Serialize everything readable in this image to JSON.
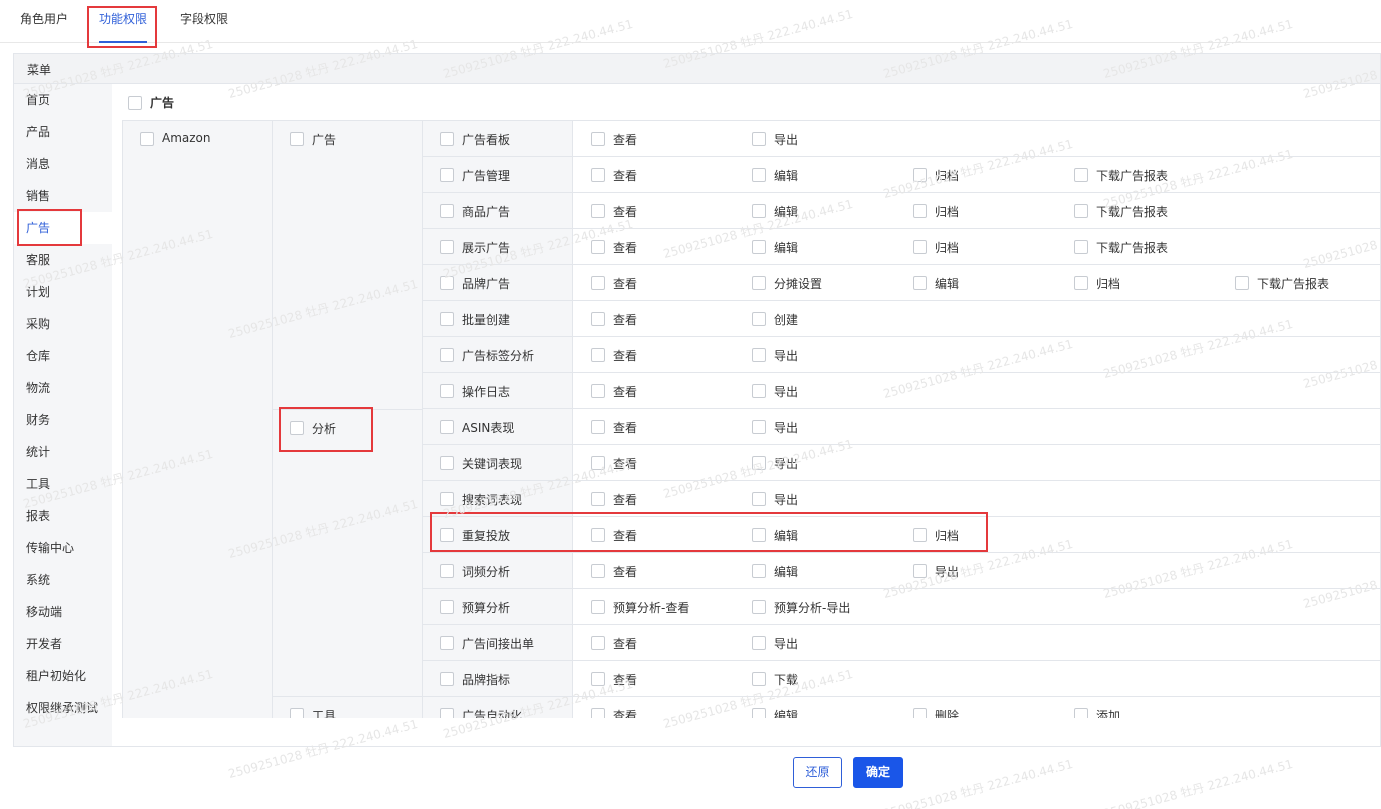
{
  "tabs": [
    {
      "label": "角色用户"
    },
    {
      "label": "功能权限"
    },
    {
      "label": "字段权限"
    }
  ],
  "panel": {
    "title": "菜单"
  },
  "menu": {
    "items": [
      {
        "label": "首页"
      },
      {
        "label": "产品"
      },
      {
        "label": "消息"
      },
      {
        "label": "销售"
      },
      {
        "label": "广告"
      },
      {
        "label": "客服"
      },
      {
        "label": "计划"
      },
      {
        "label": "采购"
      },
      {
        "label": "仓库"
      },
      {
        "label": "物流"
      },
      {
        "label": "财务"
      },
      {
        "label": "统计"
      },
      {
        "label": "工具"
      },
      {
        "label": "报表"
      },
      {
        "label": "传输中心"
      },
      {
        "label": "系统"
      },
      {
        "label": "移动端"
      },
      {
        "label": "开发者"
      },
      {
        "label": "租户初始化"
      },
      {
        "label": "权限继承测试"
      }
    ],
    "active_index": 4
  },
  "module": {
    "label": "广告"
  },
  "level1": [
    {
      "label": "Amazon"
    }
  ],
  "level2": [
    {
      "label": "广告"
    },
    {
      "label": "分析"
    },
    {
      "label": "工具"
    }
  ],
  "rows": [
    {
      "label": "广告看板",
      "perms": [
        "查看",
        "导出"
      ]
    },
    {
      "label": "广告管理",
      "perms": [
        "查看",
        "编辑",
        "归档",
        "下载广告报表"
      ]
    },
    {
      "label": "商品广告",
      "perms": [
        "查看",
        "编辑",
        "归档",
        "下载广告报表"
      ]
    },
    {
      "label": "展示广告",
      "perms": [
        "查看",
        "编辑",
        "归档",
        "下载广告报表"
      ]
    },
    {
      "label": "品牌广告",
      "perms": [
        "查看",
        "分摊设置",
        "编辑",
        "归档",
        "下载广告报表"
      ]
    },
    {
      "label": "批量创建",
      "perms": [
        "查看",
        "创建"
      ]
    },
    {
      "label": "广告标签分析",
      "perms": [
        "查看",
        "导出"
      ]
    },
    {
      "label": "操作日志",
      "perms": [
        "查看",
        "导出"
      ]
    },
    {
      "label": "ASIN表现",
      "perms": [
        "查看",
        "导出"
      ]
    },
    {
      "label": "关键词表现",
      "perms": [
        "查看",
        "导出"
      ]
    },
    {
      "label": "搜索词表现",
      "perms": [
        "查看",
        "导出"
      ]
    },
    {
      "label": "重复投放",
      "perms": [
        "查看",
        "编辑",
        "归档"
      ]
    },
    {
      "label": "词频分析",
      "perms": [
        "查看",
        "编辑",
        "导出"
      ]
    },
    {
      "label": "预算分析",
      "perms": [
        "预算分析-查看",
        "预算分析-导出"
      ]
    },
    {
      "label": "广告间接出单",
      "perms": [
        "查看",
        "导出"
      ]
    },
    {
      "label": "品牌指标",
      "perms": [
        "查看",
        "下载"
      ]
    },
    {
      "label": "广告自动化",
      "perms": [
        "查看",
        "编辑",
        "删除",
        "添加"
      ]
    }
  ],
  "footer": {
    "reset_label": "还原",
    "confirm_label": "确定"
  },
  "watermark": "2509251028 牡丹 222.240.44.51",
  "colors": {
    "accent": "#2f5fd8",
    "primary_button": "#1a56e8",
    "highlight": "#e4393c"
  }
}
